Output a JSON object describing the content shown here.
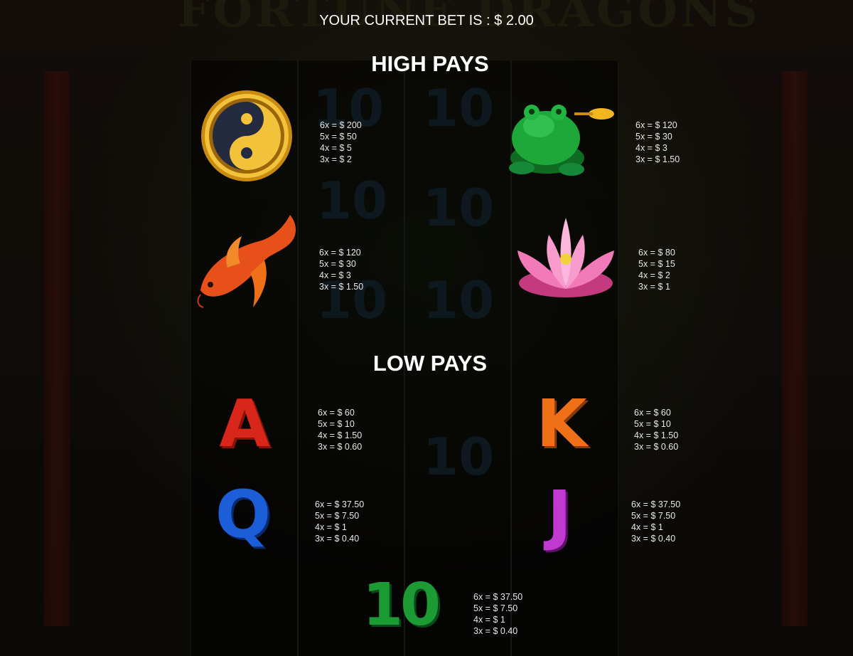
{
  "background": {
    "logo_text": "FORTUNE DRAGONS"
  },
  "bet": {
    "label": "YOUR CURRENT BET IS : $ 2.00"
  },
  "sections": {
    "high": "HIGH PAYS",
    "low": "LOW PAYS"
  },
  "symbols": {
    "yinyang": {
      "icon": "yin-yang-coin-icon",
      "pays": [
        "6x = $ 200",
        "5x = $ 50",
        "4x = $ 5",
        "3x = $ 2"
      ]
    },
    "toad": {
      "icon": "jade-toad-icon",
      "pays": [
        "6x = $ 120",
        "5x = $ 30",
        "4x = $ 3",
        "3x = $ 1.50"
      ]
    },
    "koi": {
      "icon": "koi-fish-icon",
      "pays": [
        "6x = $ 120",
        "5x = $ 30",
        "4x = $ 3",
        "3x = $ 1.50"
      ]
    },
    "lotus": {
      "icon": "lotus-flower-icon",
      "pays": [
        "6x = $ 80",
        "5x = $ 15",
        "4x = $ 2",
        "3x = $ 1"
      ]
    },
    "ace": {
      "icon": "ace-symbol-icon",
      "glyph": "A",
      "pays": [
        "6x = $ 60",
        "5x = $ 10",
        "4x = $ 1.50",
        "3x = $ 0.60"
      ]
    },
    "king": {
      "icon": "king-symbol-icon",
      "glyph": "K",
      "pays": [
        "6x = $ 60",
        "5x = $ 10",
        "4x = $ 1.50",
        "3x = $ 0.60"
      ]
    },
    "queen": {
      "icon": "queen-symbol-icon",
      "glyph": "Q",
      "pays": [
        "6x = $ 37.50",
        "5x = $ 7.50",
        "4x = $ 1",
        "3x = $ 0.40"
      ]
    },
    "jack": {
      "icon": "jack-symbol-icon",
      "glyph": "J",
      "pays": [
        "6x = $ 37.50",
        "5x = $ 7.50",
        "4x = $ 1",
        "3x = $ 0.40"
      ]
    },
    "ten": {
      "icon": "ten-symbol-icon",
      "glyph": "10",
      "pays": [
        "6x = $ 37.50",
        "5x = $ 7.50",
        "4x = $ 1",
        "3x = $ 0.40"
      ]
    }
  },
  "colors": {
    "text": "#ffffff",
    "paytable_text": "#e8e8e8",
    "gold": "#e8a820",
    "jade": "#1fa83a",
    "red": "#d8261a",
    "orange": "#f07018",
    "blue": "#1c5ed8",
    "purple": "#c03ad0",
    "green": "#1c9a34"
  }
}
